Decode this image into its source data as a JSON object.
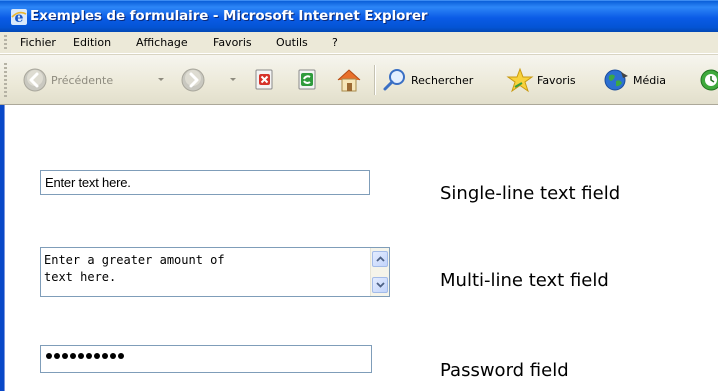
{
  "window": {
    "title": "Exemples de formulaire - Microsoft Internet Explorer",
    "app_icon": "ie-icon"
  },
  "menubar": {
    "items": [
      {
        "label": "Fichier"
      },
      {
        "label": "Edition"
      },
      {
        "label": "Affichage"
      },
      {
        "label": "Favoris"
      },
      {
        "label": "Outils"
      },
      {
        "label": "?"
      }
    ]
  },
  "toolbar": {
    "back_label": "Précédente",
    "search_label": "Rechercher",
    "favorites_label": "Favoris",
    "media_label": "Média",
    "icons": [
      "back-icon",
      "forward-icon",
      "stop-icon",
      "refresh-icon",
      "home-icon",
      "search-icon",
      "favorites-icon",
      "media-icon",
      "history-icon"
    ]
  },
  "form": {
    "single_line": {
      "value": "Enter text here.",
      "label": "Single-line text field"
    },
    "multi_line": {
      "value": "Enter a greater amount of\ntext here.",
      "label": "Multi-line text field"
    },
    "password": {
      "masked_length": 10,
      "label": "Password field"
    }
  },
  "colors": {
    "title_bar": "#0a5be6",
    "chrome": "#ece9d8",
    "input_border": "#7f9db9"
  }
}
